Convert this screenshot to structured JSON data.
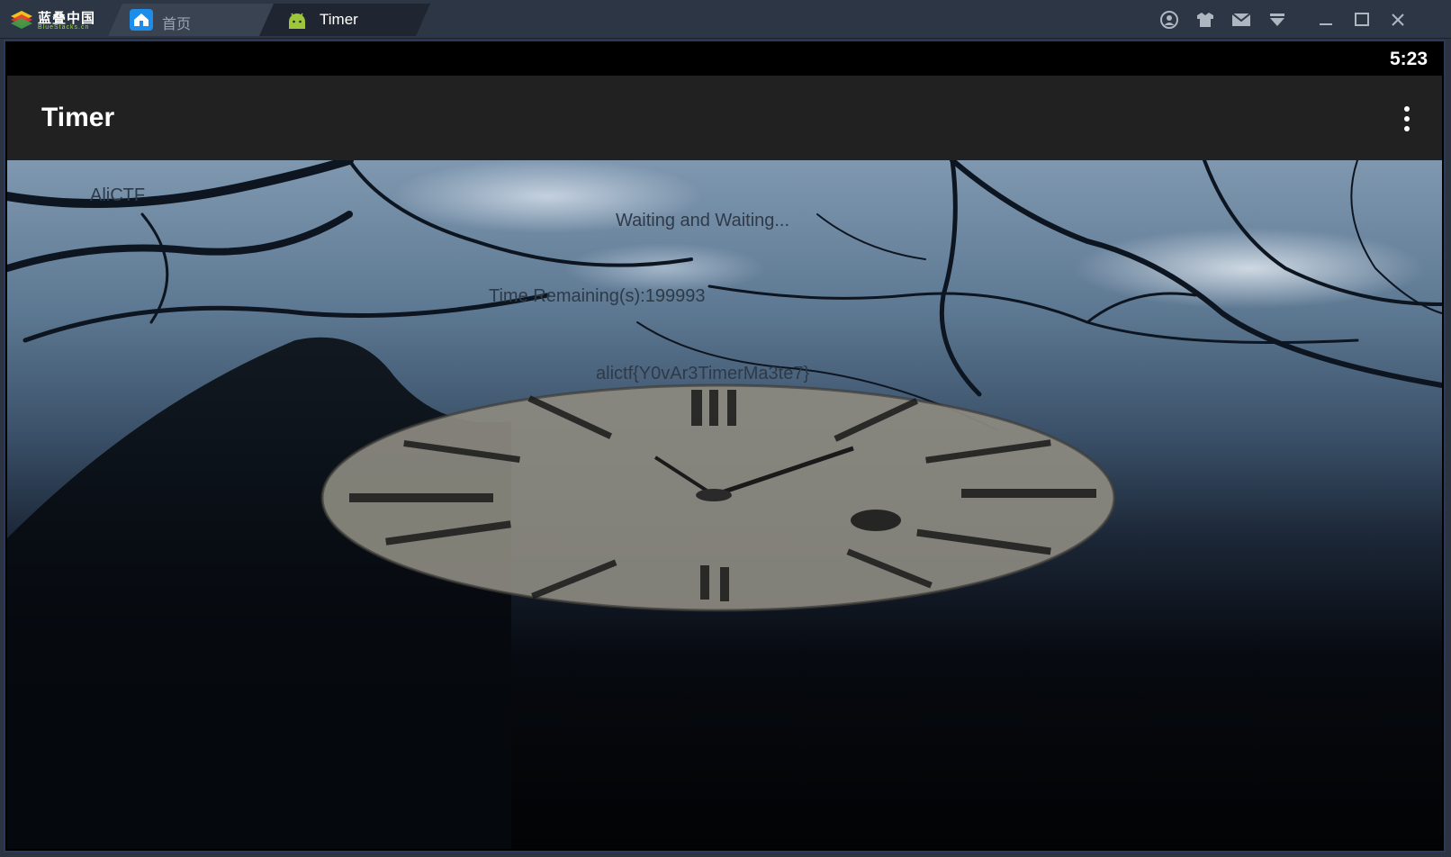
{
  "emulator": {
    "brand_text": "蓝叠中国",
    "brand_sub": "BlueStacks.cn",
    "tabs": [
      {
        "label": "首页",
        "icon": "home-icon",
        "active": false
      },
      {
        "label": "Timer",
        "icon": "android-icon",
        "active": true
      }
    ],
    "controls": [
      "account-icon",
      "gift-icon",
      "mail-icon",
      "download-icon",
      "minimize-icon",
      "maximize-icon",
      "close-icon"
    ]
  },
  "android": {
    "status_time": "5:23",
    "app_title": "Timer",
    "overflow_icon": "more-vert-icon",
    "texts": {
      "brand": "AliCTF",
      "waiting": "Waiting and Waiting...",
      "remaining": "Time Remaining(s):199993",
      "flag": "alictf{Y0vAr3TimerMa3te7}"
    },
    "background_image": "clock-with-bare-tree-branches"
  },
  "colors": {
    "titlebar": "#2d3644",
    "appbar": "#212121",
    "statusbar": "#000000",
    "text_on_image": "#2e3a48",
    "accent_blue": "#1c8de8",
    "android_green": "#9fc63b"
  }
}
